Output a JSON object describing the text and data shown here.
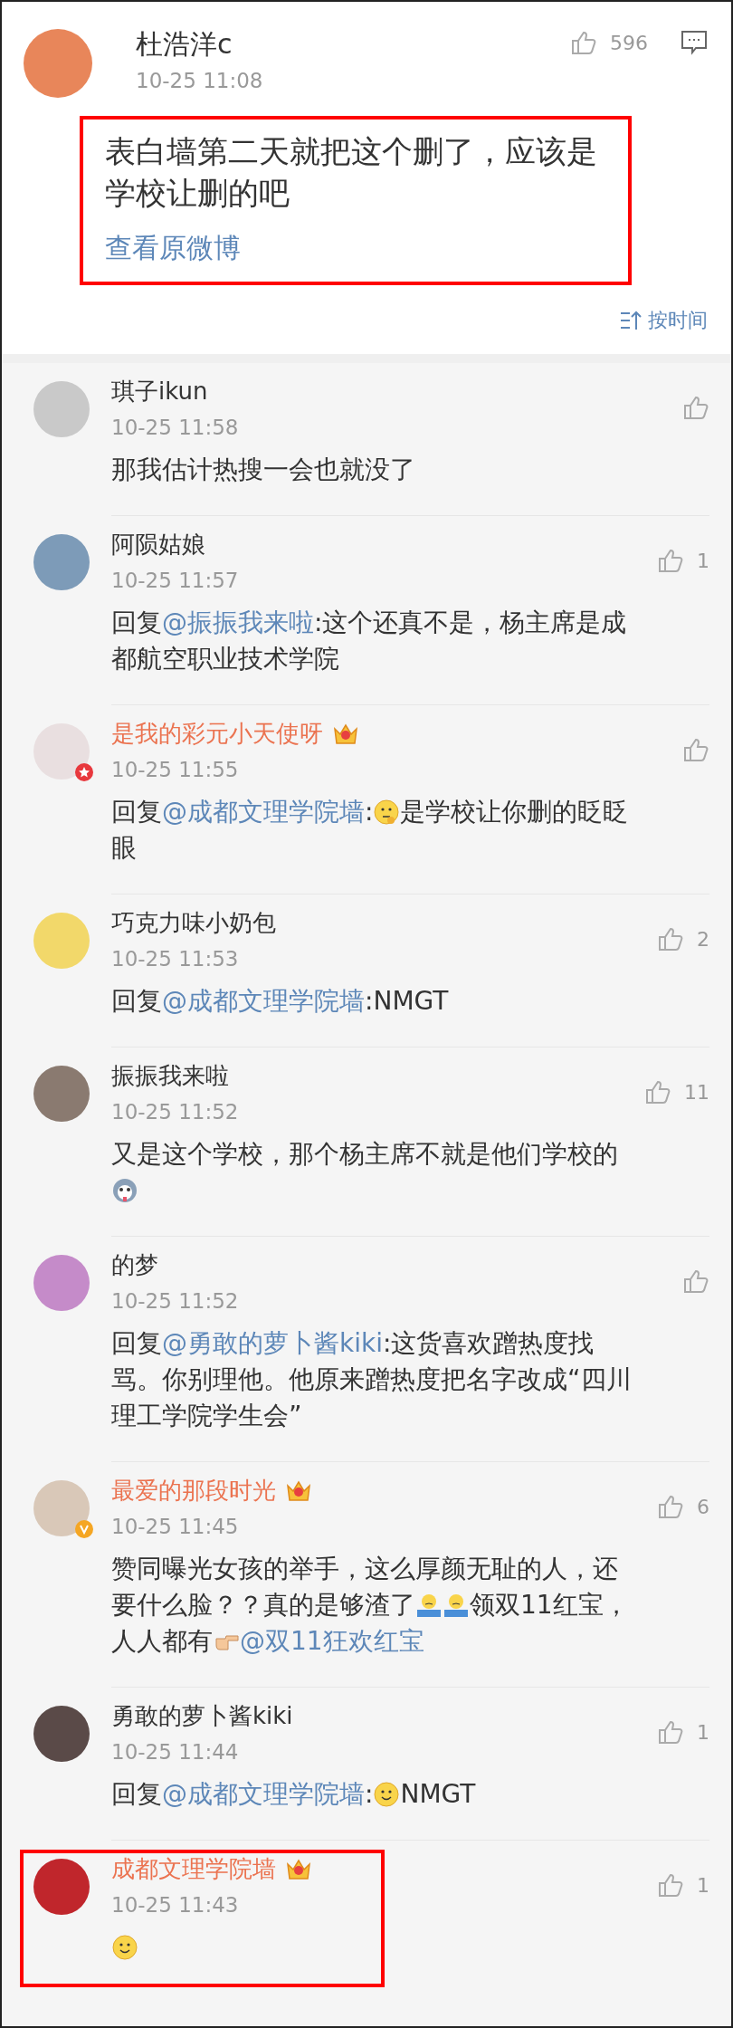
{
  "original_comment": {
    "author": "杜浩洋c",
    "star_badge": false,
    "verified": false,
    "vip": false,
    "time": "10-25 11:08",
    "likes": "596",
    "highlighted": true,
    "body": "表白墙第二天就把这个删了，应该是学校让删的吧",
    "link": "查看原微博",
    "sort": "按时间"
  },
  "replies": [
    {
      "author": "琪子ikun",
      "vip": false,
      "star_badge": false,
      "verified": false,
      "time": "10-25 11:58",
      "highlighted": false,
      "body": [
        {
          "kind": "text",
          "text": "那我估计热搜一会也就没了"
        }
      ]
    },
    {
      "author": "阿陨姑娘",
      "vip": false,
      "star_badge": false,
      "verified": false,
      "time": "10-25 11:57",
      "likes": "1",
      "highlighted": false,
      "body": [
        {
          "kind": "text",
          "text": "回复"
        },
        {
          "kind": "mention",
          "text": "@振振我来啦"
        },
        {
          "kind": "text",
          "text": ":这个还真不是，杨主席是成都航空职业技术学院"
        }
      ]
    },
    {
      "author": "是我的彩元小天使呀",
      "vip": true,
      "star_badge": true,
      "verified": false,
      "time": "10-25 11:55",
      "highlighted": false,
      "body": [
        {
          "kind": "text",
          "text": "回复"
        },
        {
          "kind": "mention",
          "text": "@成都文理学院墙"
        },
        {
          "kind": "text",
          "text": ":"
        },
        {
          "kind": "think"
        },
        {
          "kind": "text",
          "text": "是学校让你删的眨眨眼"
        }
      ]
    },
    {
      "author": "巧克力味小奶包",
      "vip": false,
      "star_badge": false,
      "verified": false,
      "time": "10-25 11:53",
      "likes": "2",
      "highlighted": false,
      "body": [
        {
          "kind": "text",
          "text": "回复"
        },
        {
          "kind": "mention",
          "text": "@成都文理学院墙"
        },
        {
          "kind": "text",
          "text": ":NMGT"
        }
      ]
    },
    {
      "author": "振振我来啦",
      "vip": false,
      "star_badge": false,
      "verified": false,
      "time": "10-25 11:52",
      "likes": "11",
      "highlighted": false,
      "body": [
        {
          "kind": "text",
          "text": "又是这个学校，那个杨主席不就是他们学校的"
        },
        {
          "kind": "dog"
        }
      ]
    },
    {
      "author": "的梦",
      "vip": false,
      "star_badge": false,
      "verified": false,
      "time": "10-25 11:52",
      "highlighted": false,
      "body": [
        {
          "kind": "text",
          "text": "回复"
        },
        {
          "kind": "mention",
          "text": "@勇敢的萝卜酱kiki"
        },
        {
          "kind": "text",
          "text": ":这货喜欢蹭热度找骂。你别理他。他原来蹭热度把名字改成“四川理工学院学生会”"
        }
      ]
    },
    {
      "author": "最爱的那段时光",
      "vip": true,
      "star_badge": false,
      "verified": true,
      "time": "10-25 11:45",
      "likes": "6",
      "highlighted": false,
      "body": [
        {
          "kind": "text",
          "text": "赞同曝光女孩的举手，这么厚颜无耻的人，还要什么脸？？真的是够渣了"
        },
        {
          "kind": "shrug"
        },
        {
          "kind": "shrug"
        },
        {
          "kind": "text",
          "text": "领双11红宝，人人都有"
        },
        {
          "kind": "point"
        },
        {
          "kind": "mention",
          "text": "@双11狂欢红宝"
        }
      ]
    },
    {
      "author": "勇敢的萝卜酱kiki",
      "vip": false,
      "star_badge": false,
      "verified": false,
      "time": "10-25 11:44",
      "likes": "1",
      "highlighted": false,
      "body": [
        {
          "kind": "text",
          "text": "回复"
        },
        {
          "kind": "mention",
          "text": "@成都文理学院墙"
        },
        {
          "kind": "text",
          "text": ":"
        },
        {
          "kind": "smile"
        },
        {
          "kind": "text",
          "text": "NMGT"
        }
      ]
    },
    {
      "author": "成都文理学院墙",
      "vip": true,
      "star_badge": false,
      "verified": false,
      "time": "10-25 11:43",
      "likes": "1",
      "highlighted": true,
      "body": [
        {
          "kind": "smile"
        }
      ]
    }
  ]
}
